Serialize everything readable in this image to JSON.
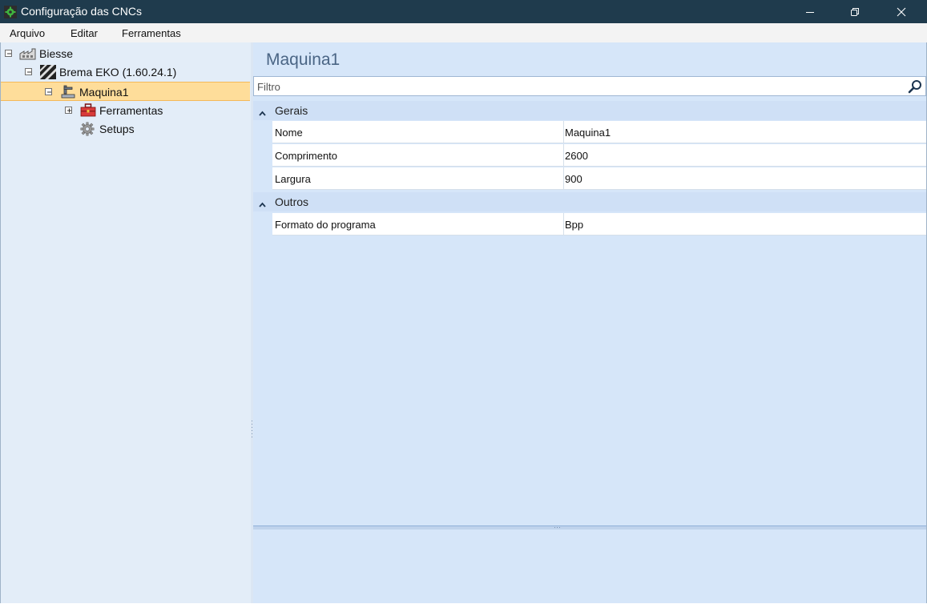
{
  "window": {
    "title": "Configuração das CNCs",
    "icon": "gear-app-icon"
  },
  "menu": {
    "items": [
      "Arquivo",
      "Editar",
      "Ferramentas"
    ]
  },
  "tree": {
    "nodes": [
      {
        "label": "Biesse",
        "icon": "factory-icon",
        "expander": "minus",
        "level": 0
      },
      {
        "label": "Brema EKO (1.60.24.1)",
        "icon": "stripes-icon",
        "expander": "minus",
        "level": 1
      },
      {
        "label": "Maquina1",
        "icon": "machine-icon",
        "expander": "minus",
        "level": 2,
        "selected": true
      },
      {
        "label": "Ferramentas",
        "icon": "toolbox-icon",
        "expander": "plus",
        "level": 3
      },
      {
        "label": "Setups",
        "icon": "gear-icon",
        "expander": "none",
        "level": 3
      }
    ]
  },
  "panel": {
    "title": "Maquina1",
    "filter_placeholder": "Filtro",
    "categories": [
      {
        "label": "Gerais",
        "rows": [
          {
            "name": "Nome",
            "value": "Maquina1"
          },
          {
            "name": "Comprimento",
            "value": "2600"
          },
          {
            "name": "Largura",
            "value": "900"
          }
        ]
      },
      {
        "label": "Outros",
        "rows": [
          {
            "name": "Formato do programa",
            "value": "Bpp"
          }
        ]
      }
    ]
  },
  "colors": {
    "titlebar": "#1f3b4d",
    "selection": "#fedd9a",
    "panel_bg": "#d6e6f9",
    "tree_bg": "#e3edf8"
  }
}
